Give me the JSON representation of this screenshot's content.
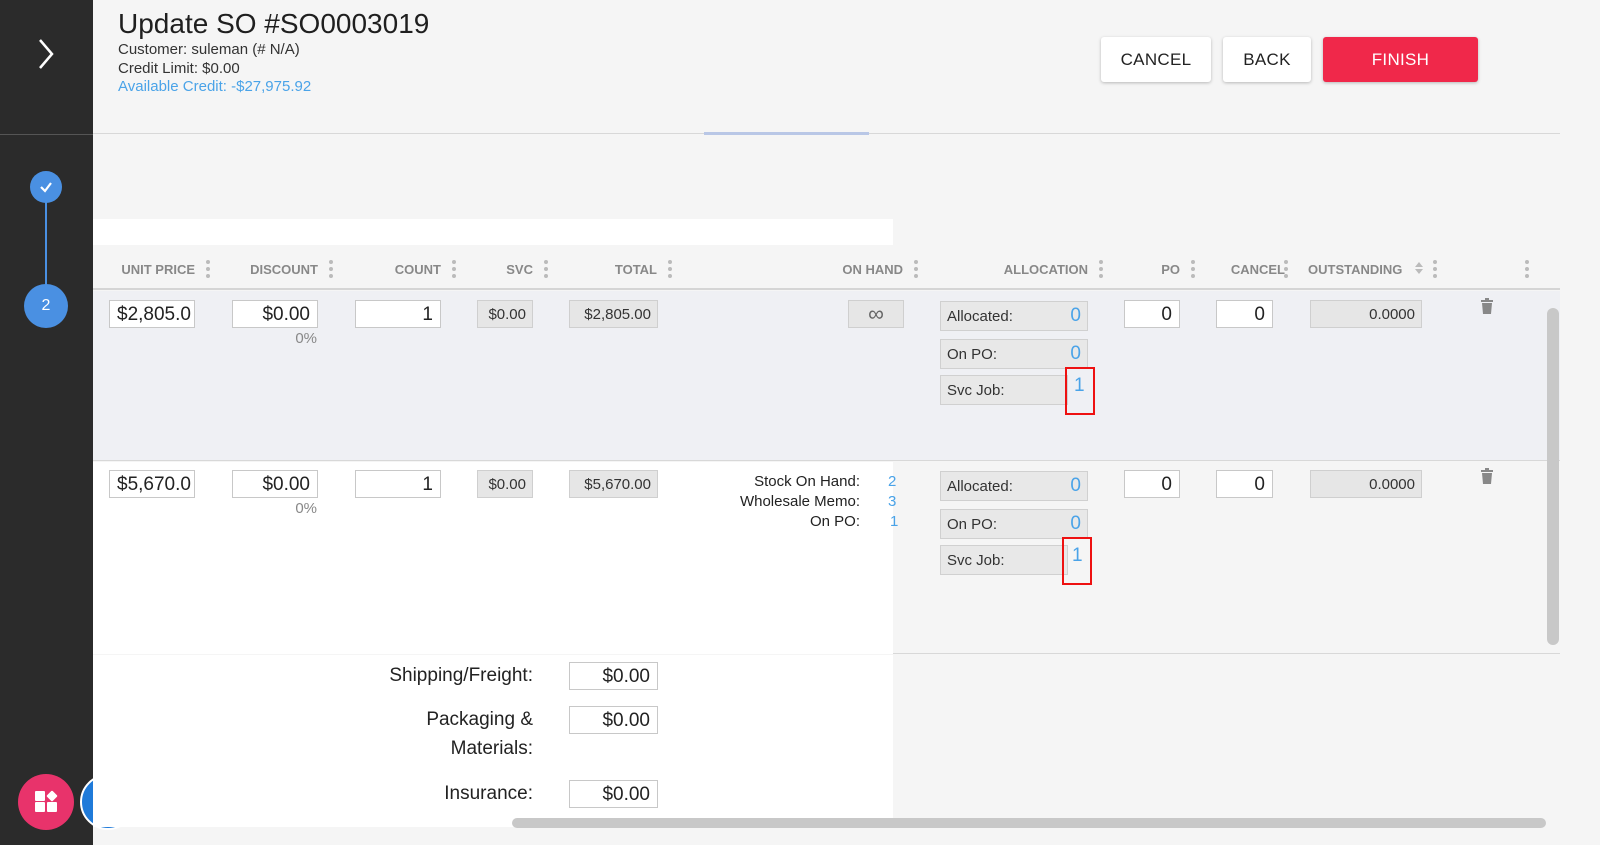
{
  "header": {
    "title": "Update SO #SO0003019",
    "customer": "Customer: suleman (# N/A)",
    "credit_limit": "Credit Limit: $0.00",
    "available_credit": "Available Credit: -$27,975.92",
    "cancel_label": "CANCEL",
    "back_label": "BACK",
    "finish_label": "FINISH",
    "finish_color": "#f0284a"
  },
  "sidebar": {
    "step2_label": "2",
    "accent": "#4a90e2"
  },
  "columns": {
    "unit_price": "UNIT PRICE",
    "discount": "DISCOUNT",
    "count": "COUNT",
    "svc": "SVC",
    "total": "TOTAL",
    "on_hand": "ON HAND",
    "allocation": "ALLOCATION",
    "po": "PO",
    "cancel": "CANCEL",
    "outstanding": "OUTSTANDING"
  },
  "rows": [
    {
      "unit_price": "$2,805.0",
      "discount": "$0.00",
      "discount_pct": "0%",
      "count": "1",
      "svc": "$0.00",
      "total": "$2,805.00",
      "on_hand": "∞",
      "allocated_label": "Allocated:",
      "allocated": "0",
      "on_po_label": "On PO:",
      "on_po": "0",
      "svc_job_label": "Svc Job:",
      "svc_job": "1",
      "po": "0",
      "cancel": "0",
      "outstanding": "0.0000"
    },
    {
      "unit_price": "$5,670.0",
      "discount": "$0.00",
      "discount_pct": "0%",
      "count": "1",
      "svc": "$0.00",
      "total": "$5,670.00",
      "stock_on_hand_label": "Stock On Hand:",
      "stock_on_hand": "2",
      "wholesale_memo_label": "Wholesale Memo:",
      "wholesale_memo": "3",
      "on_po_stock_label": "On PO:",
      "on_po_stock": "1",
      "allocated_label": "Allocated:",
      "allocated": "0",
      "on_po_label": "On PO:",
      "on_po": "0",
      "svc_job_label": "Svc Job:",
      "svc_job": "1",
      "po": "0",
      "cancel": "0",
      "outstanding": "0.0000"
    }
  ],
  "footer": {
    "shipping_label": "Shipping/Freight:",
    "shipping": "$0.00",
    "packaging_label_1": "Packaging &",
    "packaging_label_2": "Materials:",
    "packaging": "$0.00",
    "insurance_label": "Insurance:",
    "insurance": "$0.00"
  },
  "icons": [
    "chevron-right-icon",
    "check-icon",
    "trash-icon",
    "apps-icon",
    "support-agent-icon"
  ]
}
